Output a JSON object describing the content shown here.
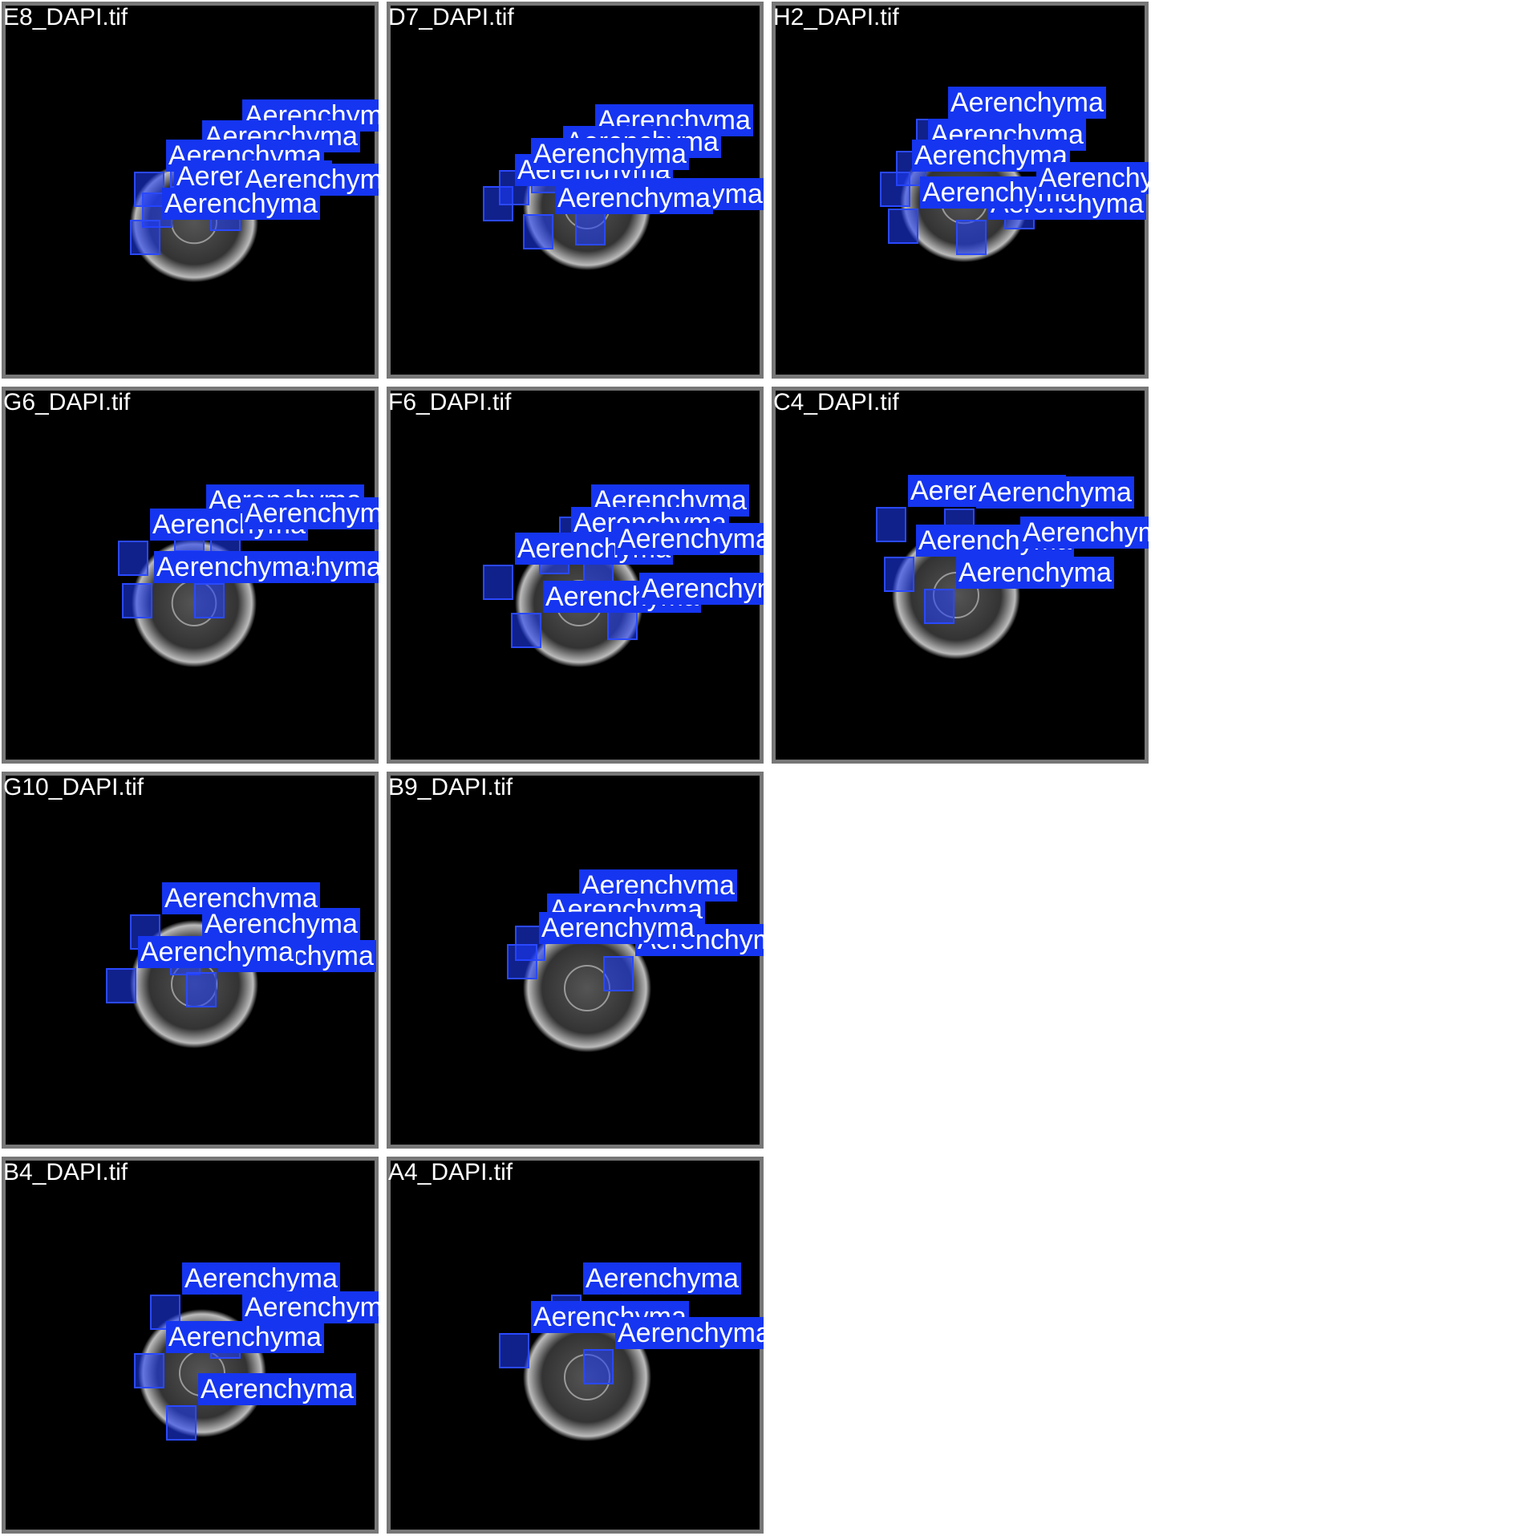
{
  "colors": {
    "panel_border": "#777777",
    "image_bg": "#000000",
    "label_bg": "#1535f0",
    "title_text": "#ffffff"
  },
  "annotation_class": "Aerenchyma",
  "panels": [
    {
      "title": "E8_DAPI.tif"
    },
    {
      "title": "D7_DAPI.tif"
    },
    {
      "title": "H2_DAPI.tif"
    },
    {
      "title": "G6_DAPI.tif"
    },
    {
      "title": "F6_DAPI.tif"
    },
    {
      "title": "C4_DAPI.tif"
    },
    {
      "title": "G10_DAPI.tif"
    },
    {
      "title": "B9_DAPI.tif"
    },
    {
      "title": "B4_DAPI.tif"
    },
    {
      "title": "A4_DAPI.tif"
    }
  ]
}
